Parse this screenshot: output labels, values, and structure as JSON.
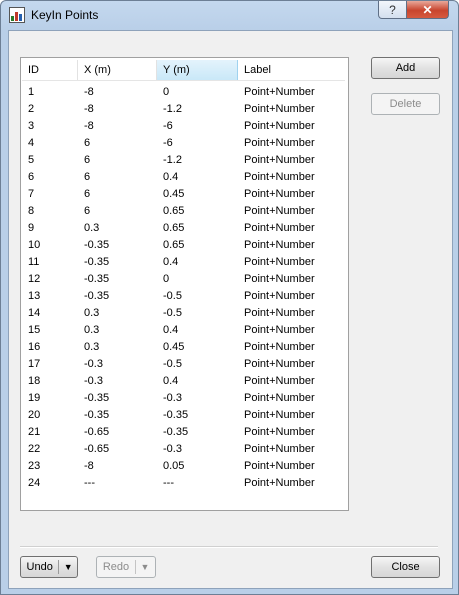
{
  "window": {
    "title": "KeyIn Points",
    "help_label": "?",
    "close_label": "✕"
  },
  "table": {
    "headers": [
      "ID",
      "X (m)",
      "Y (m)",
      "Label"
    ],
    "rows": [
      [
        "1",
        "-8",
        "0",
        "Point+Number"
      ],
      [
        "2",
        "-8",
        "-1.2",
        "Point+Number"
      ],
      [
        "3",
        "-8",
        "-6",
        "Point+Number"
      ],
      [
        "4",
        "6",
        "-6",
        "Point+Number"
      ],
      [
        "5",
        "6",
        "-1.2",
        "Point+Number"
      ],
      [
        "6",
        "6",
        "0.4",
        "Point+Number"
      ],
      [
        "7",
        "6",
        "0.45",
        "Point+Number"
      ],
      [
        "8",
        "6",
        "0.65",
        "Point+Number"
      ],
      [
        "9",
        "0.3",
        "0.65",
        "Point+Number"
      ],
      [
        "10",
        "-0.35",
        "0.65",
        "Point+Number"
      ],
      [
        "11",
        "-0.35",
        "0.4",
        "Point+Number"
      ],
      [
        "12",
        "-0.35",
        "0",
        "Point+Number"
      ],
      [
        "13",
        "-0.35",
        "-0.5",
        "Point+Number"
      ],
      [
        "14",
        "0.3",
        "-0.5",
        "Point+Number"
      ],
      [
        "15",
        "0.3",
        "0.4",
        "Point+Number"
      ],
      [
        "16",
        "0.3",
        "0.45",
        "Point+Number"
      ],
      [
        "17",
        "-0.3",
        "-0.5",
        "Point+Number"
      ],
      [
        "18",
        "-0.3",
        "0.4",
        "Point+Number"
      ],
      [
        "19",
        "-0.35",
        "-0.3",
        "Point+Number"
      ],
      [
        "20",
        "-0.35",
        "-0.35",
        "Point+Number"
      ],
      [
        "21",
        "-0.65",
        "-0.35",
        "Point+Number"
      ],
      [
        "22",
        "-0.65",
        "-0.3",
        "Point+Number"
      ],
      [
        "23",
        "-8",
        "0.05",
        "Point+Number"
      ],
      [
        "24",
        "---",
        "---",
        "Point+Number"
      ]
    ]
  },
  "buttons": {
    "add": "Add",
    "delete": "Delete",
    "undo": "Undo",
    "redo": "Redo",
    "close": "Close"
  },
  "colors": {
    "titlebar": "#b9cfe8",
    "close_button": "#c8452e",
    "selected_header": "#c9e8f8"
  }
}
